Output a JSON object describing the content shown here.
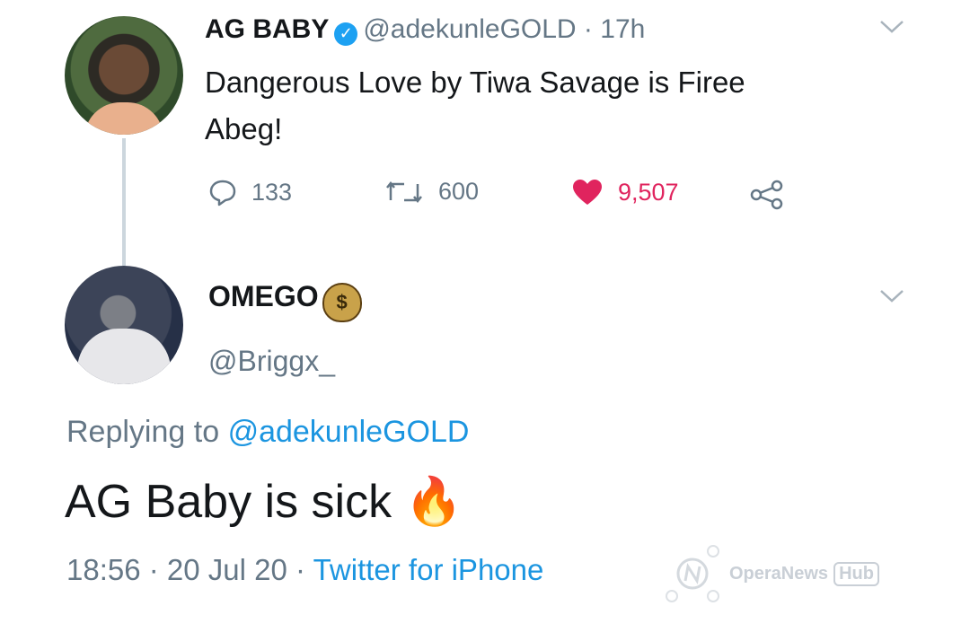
{
  "parent": {
    "name": "AG BABY",
    "handle": "@adekunleGOLD",
    "time": "17h",
    "text_line1": "Dangerous Love by Tiwa Savage is Firee",
    "text_line2": "Abeg!",
    "replies": "133",
    "retweets": "600",
    "likes": "9,507",
    "like_color": "#e0245e"
  },
  "reply": {
    "name": "OMEGO",
    "handle": "@Briggx_",
    "replying_label": "Replying to",
    "replying_handle": "@adekunleGOLD",
    "text": "AG Baby is sick",
    "timestamp": "18:56 · 20 Jul 20 ·",
    "source": "Twitter for iPhone",
    "emoji": "🔥"
  },
  "watermark": {
    "brand": "OperaNews",
    "suffix": "Hub"
  },
  "colors": {
    "link": "#1b95e0",
    "verified": "#1da1f2",
    "muted": "#657786"
  }
}
